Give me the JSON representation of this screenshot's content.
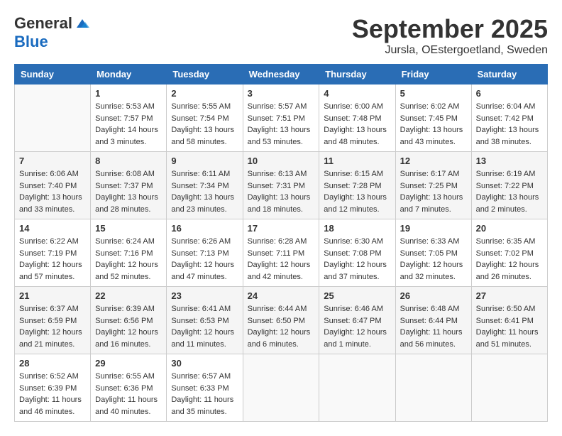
{
  "header": {
    "logo_general": "General",
    "logo_blue": "Blue",
    "month_title": "September 2025",
    "location": "Jursla, OEstergoetland, Sweden"
  },
  "days_of_week": [
    "Sunday",
    "Monday",
    "Tuesday",
    "Wednesday",
    "Thursday",
    "Friday",
    "Saturday"
  ],
  "weeks": [
    [
      {
        "day": "",
        "sunrise": "",
        "sunset": "",
        "daylight": "",
        "empty": true
      },
      {
        "day": "1",
        "sunrise": "Sunrise: 5:53 AM",
        "sunset": "Sunset: 7:57 PM",
        "daylight": "Daylight: 14 hours and 3 minutes."
      },
      {
        "day": "2",
        "sunrise": "Sunrise: 5:55 AM",
        "sunset": "Sunset: 7:54 PM",
        "daylight": "Daylight: 13 hours and 58 minutes."
      },
      {
        "day": "3",
        "sunrise": "Sunrise: 5:57 AM",
        "sunset": "Sunset: 7:51 PM",
        "daylight": "Daylight: 13 hours and 53 minutes."
      },
      {
        "day": "4",
        "sunrise": "Sunrise: 6:00 AM",
        "sunset": "Sunset: 7:48 PM",
        "daylight": "Daylight: 13 hours and 48 minutes."
      },
      {
        "day": "5",
        "sunrise": "Sunrise: 6:02 AM",
        "sunset": "Sunset: 7:45 PM",
        "daylight": "Daylight: 13 hours and 43 minutes."
      },
      {
        "day": "6",
        "sunrise": "Sunrise: 6:04 AM",
        "sunset": "Sunset: 7:42 PM",
        "daylight": "Daylight: 13 hours and 38 minutes."
      }
    ],
    [
      {
        "day": "7",
        "sunrise": "Sunrise: 6:06 AM",
        "sunset": "Sunset: 7:40 PM",
        "daylight": "Daylight: 13 hours and 33 minutes."
      },
      {
        "day": "8",
        "sunrise": "Sunrise: 6:08 AM",
        "sunset": "Sunset: 7:37 PM",
        "daylight": "Daylight: 13 hours and 28 minutes."
      },
      {
        "day": "9",
        "sunrise": "Sunrise: 6:11 AM",
        "sunset": "Sunset: 7:34 PM",
        "daylight": "Daylight: 13 hours and 23 minutes."
      },
      {
        "day": "10",
        "sunrise": "Sunrise: 6:13 AM",
        "sunset": "Sunset: 7:31 PM",
        "daylight": "Daylight: 13 hours and 18 minutes."
      },
      {
        "day": "11",
        "sunrise": "Sunrise: 6:15 AM",
        "sunset": "Sunset: 7:28 PM",
        "daylight": "Daylight: 13 hours and 12 minutes."
      },
      {
        "day": "12",
        "sunrise": "Sunrise: 6:17 AM",
        "sunset": "Sunset: 7:25 PM",
        "daylight": "Daylight: 13 hours and 7 minutes."
      },
      {
        "day": "13",
        "sunrise": "Sunrise: 6:19 AM",
        "sunset": "Sunset: 7:22 PM",
        "daylight": "Daylight: 13 hours and 2 minutes."
      }
    ],
    [
      {
        "day": "14",
        "sunrise": "Sunrise: 6:22 AM",
        "sunset": "Sunset: 7:19 PM",
        "daylight": "Daylight: 12 hours and 57 minutes."
      },
      {
        "day": "15",
        "sunrise": "Sunrise: 6:24 AM",
        "sunset": "Sunset: 7:16 PM",
        "daylight": "Daylight: 12 hours and 52 minutes."
      },
      {
        "day": "16",
        "sunrise": "Sunrise: 6:26 AM",
        "sunset": "Sunset: 7:13 PM",
        "daylight": "Daylight: 12 hours and 47 minutes."
      },
      {
        "day": "17",
        "sunrise": "Sunrise: 6:28 AM",
        "sunset": "Sunset: 7:11 PM",
        "daylight": "Daylight: 12 hours and 42 minutes."
      },
      {
        "day": "18",
        "sunrise": "Sunrise: 6:30 AM",
        "sunset": "Sunset: 7:08 PM",
        "daylight": "Daylight: 12 hours and 37 minutes."
      },
      {
        "day": "19",
        "sunrise": "Sunrise: 6:33 AM",
        "sunset": "Sunset: 7:05 PM",
        "daylight": "Daylight: 12 hours and 32 minutes."
      },
      {
        "day": "20",
        "sunrise": "Sunrise: 6:35 AM",
        "sunset": "Sunset: 7:02 PM",
        "daylight": "Daylight: 12 hours and 26 minutes."
      }
    ],
    [
      {
        "day": "21",
        "sunrise": "Sunrise: 6:37 AM",
        "sunset": "Sunset: 6:59 PM",
        "daylight": "Daylight: 12 hours and 21 minutes."
      },
      {
        "day": "22",
        "sunrise": "Sunrise: 6:39 AM",
        "sunset": "Sunset: 6:56 PM",
        "daylight": "Daylight: 12 hours and 16 minutes."
      },
      {
        "day": "23",
        "sunrise": "Sunrise: 6:41 AM",
        "sunset": "Sunset: 6:53 PM",
        "daylight": "Daylight: 12 hours and 11 minutes."
      },
      {
        "day": "24",
        "sunrise": "Sunrise: 6:44 AM",
        "sunset": "Sunset: 6:50 PM",
        "daylight": "Daylight: 12 hours and 6 minutes."
      },
      {
        "day": "25",
        "sunrise": "Sunrise: 6:46 AM",
        "sunset": "Sunset: 6:47 PM",
        "daylight": "Daylight: 12 hours and 1 minute."
      },
      {
        "day": "26",
        "sunrise": "Sunrise: 6:48 AM",
        "sunset": "Sunset: 6:44 PM",
        "daylight": "Daylight: 11 hours and 56 minutes."
      },
      {
        "day": "27",
        "sunrise": "Sunrise: 6:50 AM",
        "sunset": "Sunset: 6:41 PM",
        "daylight": "Daylight: 11 hours and 51 minutes."
      }
    ],
    [
      {
        "day": "28",
        "sunrise": "Sunrise: 6:52 AM",
        "sunset": "Sunset: 6:39 PM",
        "daylight": "Daylight: 11 hours and 46 minutes."
      },
      {
        "day": "29",
        "sunrise": "Sunrise: 6:55 AM",
        "sunset": "Sunset: 6:36 PM",
        "daylight": "Daylight: 11 hours and 40 minutes."
      },
      {
        "day": "30",
        "sunrise": "Sunrise: 6:57 AM",
        "sunset": "Sunset: 6:33 PM",
        "daylight": "Daylight: 11 hours and 35 minutes."
      },
      {
        "day": "",
        "sunrise": "",
        "sunset": "",
        "daylight": "",
        "empty": true
      },
      {
        "day": "",
        "sunrise": "",
        "sunset": "",
        "daylight": "",
        "empty": true
      },
      {
        "day": "",
        "sunrise": "",
        "sunset": "",
        "daylight": "",
        "empty": true
      },
      {
        "day": "",
        "sunrise": "",
        "sunset": "",
        "daylight": "",
        "empty": true
      }
    ]
  ]
}
